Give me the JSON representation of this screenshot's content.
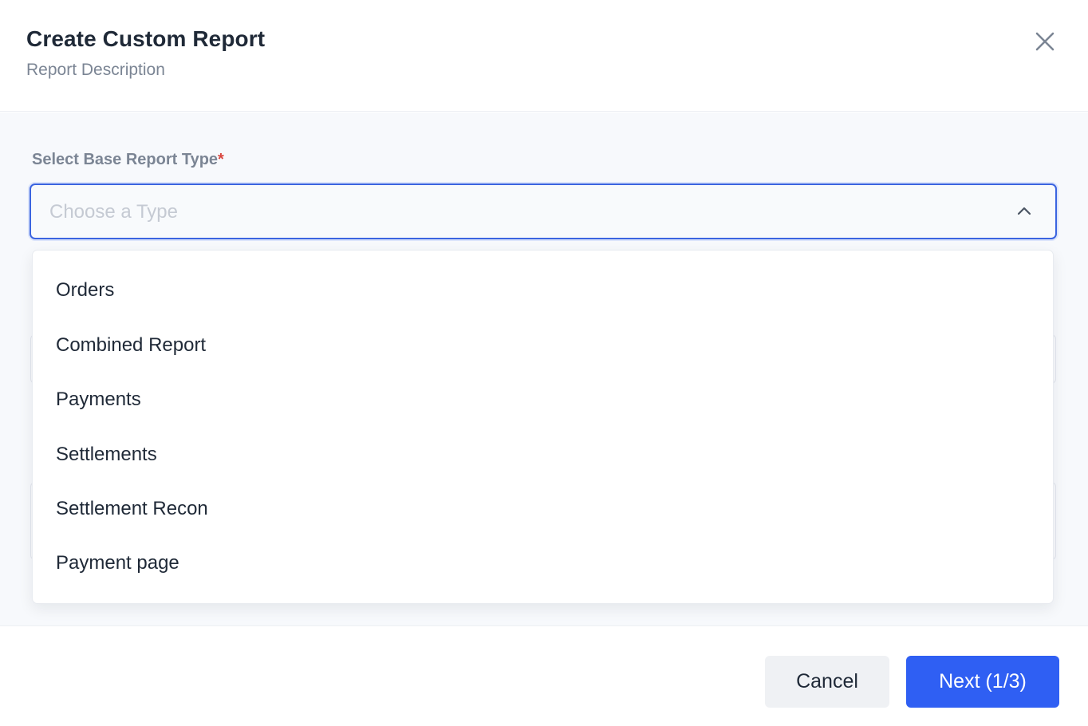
{
  "header": {
    "title": "Create Custom Report",
    "subtitle": "Report Description",
    "close_icon": "close-icon"
  },
  "form": {
    "base_type_label": "Select Base Report Type",
    "required_marker": "*",
    "select": {
      "placeholder": "Choose a Type",
      "chevron_icon": "chevron-up-icon",
      "options": [
        "Orders",
        "Combined Report",
        "Payments",
        "Settlements",
        "Settlement Recon",
        "Payment page"
      ]
    }
  },
  "footer": {
    "cancel_label": "Cancel",
    "next_label": "Next (1/3)"
  },
  "colors": {
    "accent": "#2f5ff3",
    "focus_border": "#3b64e0",
    "required": "#d9463e"
  }
}
